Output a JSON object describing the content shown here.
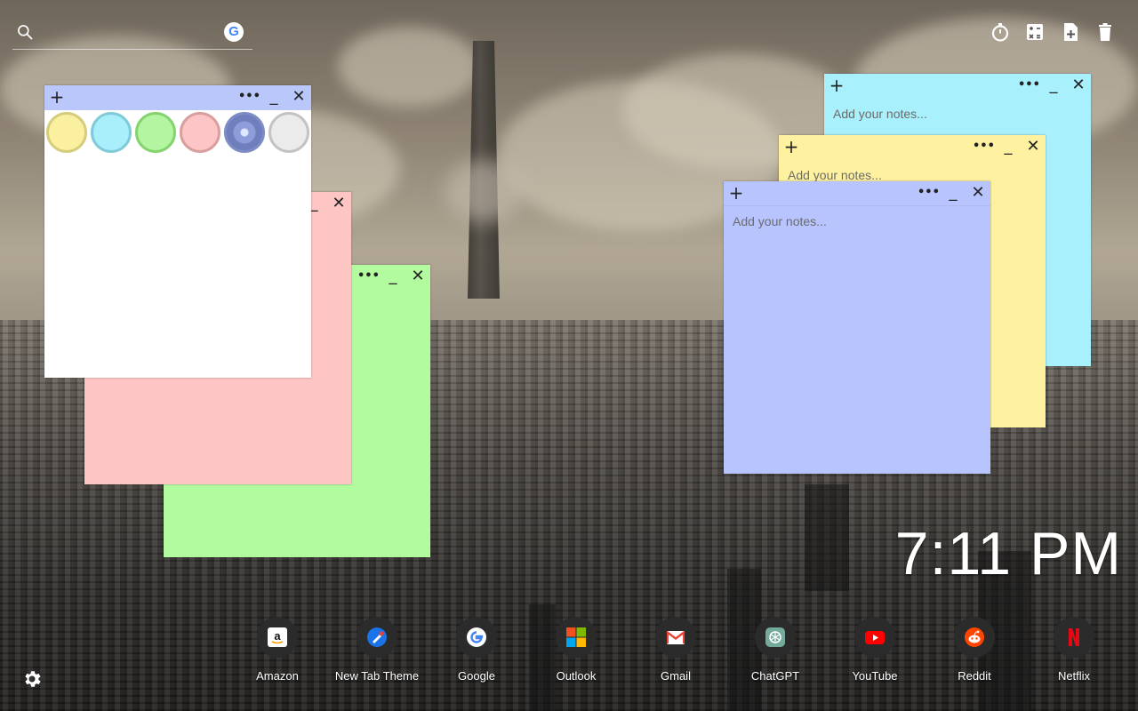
{
  "search": {
    "placeholder": "",
    "value": "",
    "engine_icon": "google-icon",
    "engine_letter": "G"
  },
  "toolbar": {
    "icons": [
      "timer-icon",
      "calculator-icon",
      "new-note-icon",
      "trash-icon"
    ]
  },
  "notes": {
    "add_symbol": "+",
    "menu_symbol": "•••",
    "minimize_symbol": "_",
    "close_symbol": "✕",
    "placeholder": "Add your notes...",
    "palette": [
      "#fbf0a0",
      "#a9eefb",
      "#b3f5a1",
      "#fdc5c5",
      "#b7c4fd",
      "#ebebeb"
    ],
    "items": [
      {
        "color": "#ffffff",
        "header": "#b9c7fb",
        "state": "color-picker-open"
      },
      {
        "color": "#fec5c5",
        "header": "#fec5c5",
        "state": "empty"
      },
      {
        "color": "#b2fb9f",
        "header": "#b2fb9f",
        "state": "empty"
      },
      {
        "color": "#a8f0fb",
        "header": "#a8f0fb",
        "state": "empty"
      },
      {
        "color": "#fef2a1",
        "header": "#fef2a1",
        "state": "empty"
      },
      {
        "color": "#b7c4fe",
        "header": "#b7c4fe",
        "state": "empty"
      }
    ]
  },
  "clock": {
    "time": "7:11 PM"
  },
  "shortcuts": [
    {
      "label": "Amazon",
      "icon": "amazon-icon"
    },
    {
      "label": "New Tab Theme",
      "icon": "new-tab-theme-icon"
    },
    {
      "label": "Google",
      "icon": "google-icon"
    },
    {
      "label": "Outlook",
      "icon": "outlook-icon"
    },
    {
      "label": "Gmail",
      "icon": "gmail-icon"
    },
    {
      "label": "ChatGPT",
      "icon": "chatgpt-icon"
    },
    {
      "label": "YouTube",
      "icon": "youtube-icon"
    },
    {
      "label": "Reddit",
      "icon": "reddit-icon"
    },
    {
      "label": "Netflix",
      "icon": "netflix-icon"
    }
  ],
  "settings": {
    "icon": "gear-icon"
  }
}
